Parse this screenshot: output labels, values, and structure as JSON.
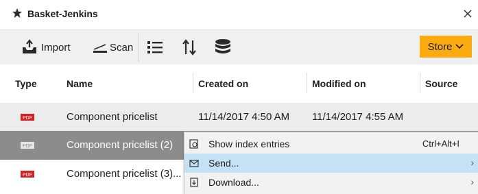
{
  "window": {
    "title": "Basket-Jenkins"
  },
  "toolbar": {
    "import_label": "Import",
    "scan_label": "Scan",
    "store_label": "Store"
  },
  "columns": {
    "type": "Type",
    "name": "Name",
    "created": "Created on",
    "modified": "Modified on",
    "source": "Source"
  },
  "rows": [
    {
      "type_icon": "pdf-icon",
      "name": "Component pricelist",
      "created": "11/14/2017 4:50 AM",
      "modified": "11/14/2017 4:55 AM",
      "state": "hover"
    },
    {
      "type_icon": "pdf-icon",
      "name": "Component pricelist (2)",
      "created": "",
      "modified": "",
      "state": "selected"
    },
    {
      "type_icon": "pdf-icon",
      "name": "Component pricelist (3)...",
      "created": "",
      "modified": "",
      "state": "normal"
    }
  ],
  "context_menu": {
    "items": [
      {
        "icon": "index-entries-icon",
        "label": "Show index entries",
        "shortcut": "Ctrl+Alt+I",
        "submenu": false
      },
      {
        "icon": "mail-icon",
        "label": "Send...",
        "shortcut": "",
        "submenu": true
      },
      {
        "icon": "download-icon",
        "label": "Download...",
        "shortcut": "",
        "submenu": true
      }
    ]
  },
  "colors": {
    "accent": "#f9ab10",
    "selected_row": "#8c8c8c",
    "menu_highlight": "#c5e1f6",
    "pdf_red": "#d42020"
  }
}
